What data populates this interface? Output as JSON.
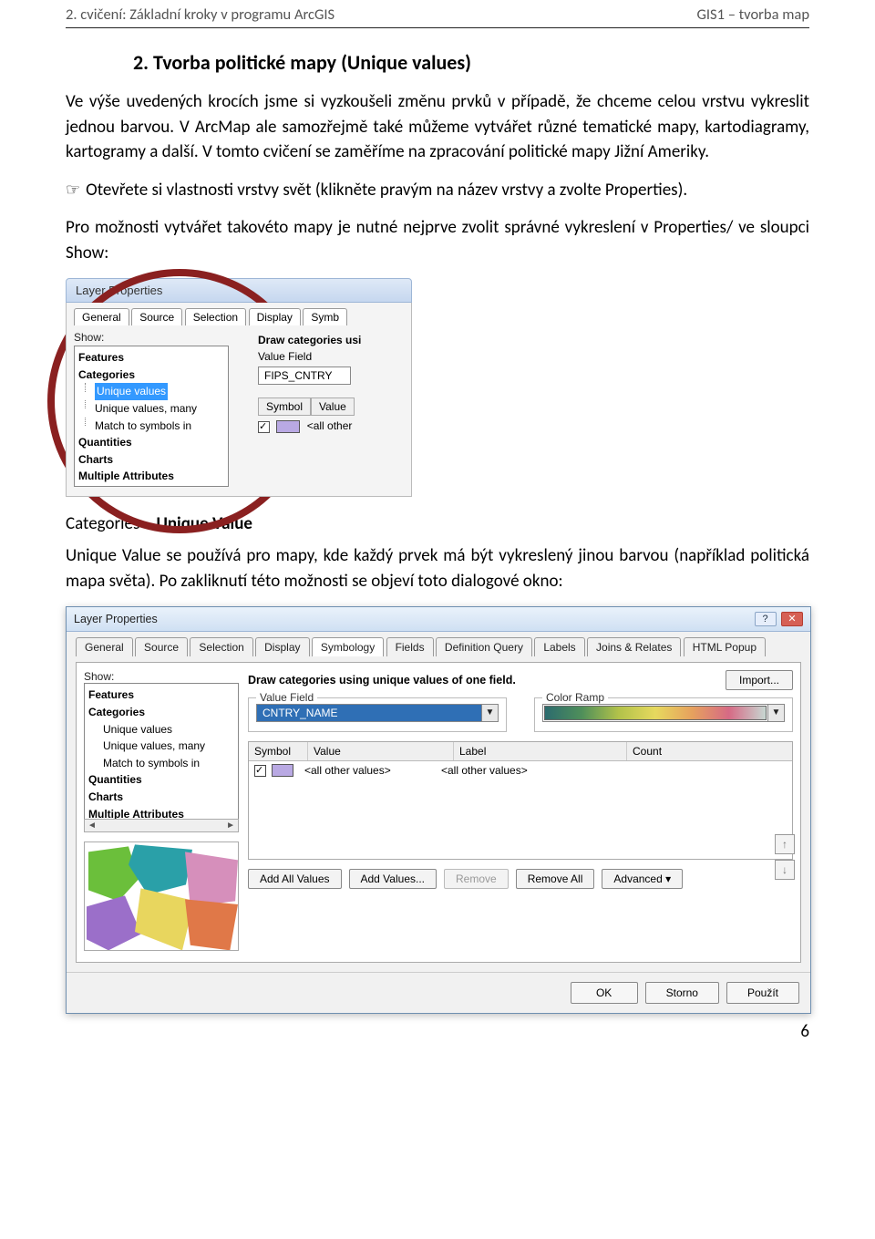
{
  "header": {
    "left": "2. cvičení: Základní kroky v programu ArcGIS",
    "right": "GIS1 – tvorba map"
  },
  "heading": "2. Tvorba politické mapy (Unique values)",
  "para1": "Ve výše uvedených krocích jsme si vyzkoušeli změnu prvků v případě, že chceme celou vrstvu vykreslit jednou barvou. V ArcMap ale samozřejmě také můžeme vytvářet různé tematické mapy, kartodiagramy, kartogramy a další. V tomto cvičení se zaměříme na zpracování politické mapy Jižní Ameriky.",
  "hand_line": "Otevřete si vlastnosti vrstvy svět (klikněte pravým na název vrstvy a zvolte Properties).",
  "para2": "Pro možnosti vytvářet takovéto mapy je nutné nejprve zvolit správné vykreslení v Properties/ ve sloupci Show:",
  "sub_heading_plain": "Categories – ",
  "sub_heading_bold": "Unique Value",
  "para3": "Unique Value se používá pro mapy, kde každý prvek má být vykreslený jinou barvou (například politická mapa světa). Po zakliknutí této možnosti se objeví toto dialogové okno:",
  "dlg1": {
    "title": "Layer Properties",
    "tabs": [
      "General",
      "Source",
      "Selection",
      "Display",
      "Symb"
    ],
    "show_label": "Show:",
    "list": {
      "features": "Features",
      "categories": "Categories",
      "uv": "Unique values",
      "uvm": "Unique values, many",
      "match": "Match to symbols in",
      "quantities": "Quantities",
      "charts": "Charts",
      "multi": "Multiple Attributes"
    },
    "right": {
      "draw": "Draw categories usi",
      "vf": "Value Field",
      "vf_val": "FIPS_CNTRY",
      "symbol": "Symbol",
      "value": "Value",
      "allother": "<all other"
    }
  },
  "dlg2": {
    "title": "Layer Properties",
    "win": {
      "help": "?",
      "close": "✕"
    },
    "tabs": [
      "General",
      "Source",
      "Selection",
      "Display",
      "Symbology",
      "Fields",
      "Definition Query",
      "Labels",
      "Joins & Relates",
      "HTML Popup"
    ],
    "active_tab": "Symbology",
    "left": {
      "show_label": "Show:",
      "features": "Features",
      "categories": "Categories",
      "uv": "Unique values",
      "uvm": "Unique values, many",
      "match": "Match to symbols in",
      "quantities": "Quantities",
      "charts": "Charts",
      "multi": "Multiple Attributes"
    },
    "right": {
      "desc": "Draw categories using unique values of one field.",
      "import": "Import...",
      "vf_legend": "Value Field",
      "vf_val": "CNTRY_NAME",
      "cr_legend": "Color Ramp",
      "tbl": {
        "c1": "Symbol",
        "c2": "Value",
        "c3": "Label",
        "c4": "Count",
        "row_value": "<all other values>",
        "row_label": "<all other values>"
      },
      "btns": {
        "addall": "Add All Values",
        "addv": "Add Values...",
        "remove": "Remove",
        "removeall": "Remove All",
        "advanced": "Advanced  ▾"
      }
    },
    "footer": {
      "ok": "OK",
      "cancel": "Storno",
      "apply": "Použít"
    }
  },
  "page_number": "6"
}
